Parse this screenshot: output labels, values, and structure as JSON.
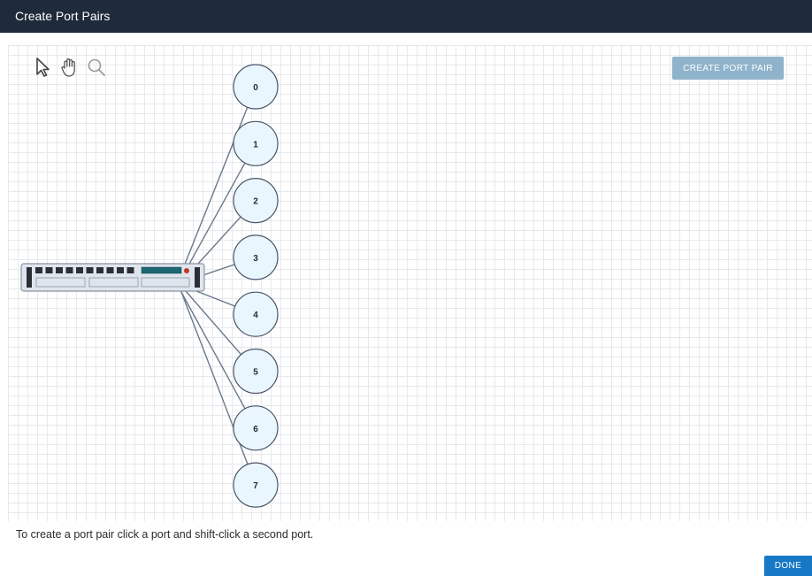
{
  "dialog": {
    "title": "Create Port Pairs"
  },
  "toolbar": {
    "tools": [
      {
        "name": "select",
        "icon": "pointer-icon"
      },
      {
        "name": "pan",
        "icon": "hand-icon"
      },
      {
        "name": "zoom",
        "icon": "magnifier-icon"
      }
    ]
  },
  "actions": {
    "create_port_pair_label": "CREATE PORT PAIR",
    "done_label": "DONE"
  },
  "topology": {
    "device": {
      "name": "switch",
      "port_count": 10
    },
    "ports": [
      "0",
      "1",
      "2",
      "3",
      "4",
      "5",
      "6",
      "7"
    ]
  },
  "instructions": "To create a port pair click a port and shift-click a second port.",
  "colors": {
    "titlebar": "#1f2a3a",
    "create_button": "#8fb3cb",
    "done_button": "#1778c6",
    "port_fill": "#eaf6fd",
    "link": "#6b7a8c"
  }
}
